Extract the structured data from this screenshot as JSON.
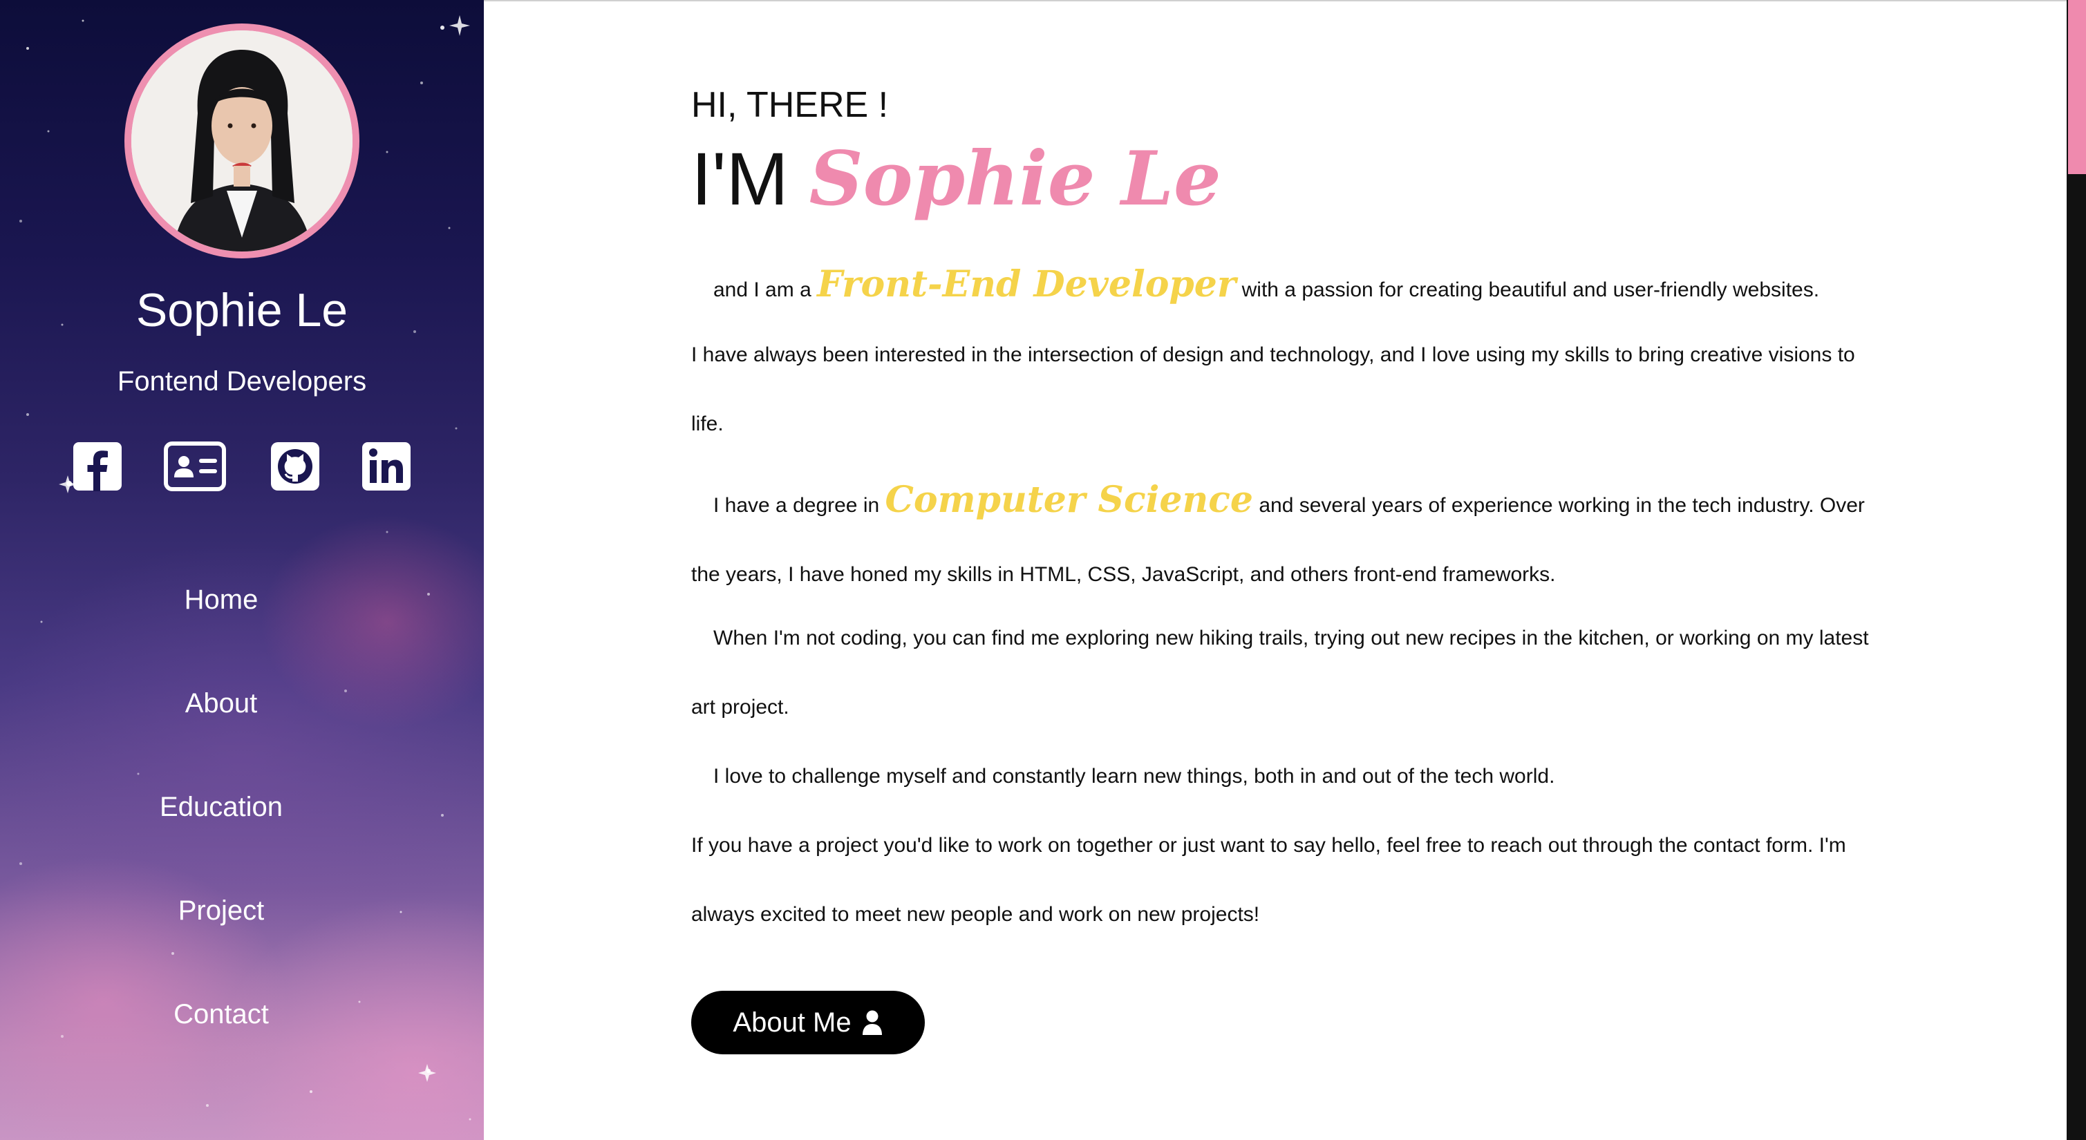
{
  "colors": {
    "accent_pink": "#ef8aae",
    "accent_yellow": "#f5d34a",
    "button_bg": "#000000",
    "sidebar_top": "#0d0d3a",
    "sidebar_bottom": "#c995c4"
  },
  "sidebar": {
    "avatar_alt": "Sophie Le profile photo",
    "name": "Sophie Le",
    "role": "Fontend Developers",
    "social": [
      {
        "icon": "facebook-icon"
      },
      {
        "icon": "contact-card-icon"
      },
      {
        "icon": "github-icon"
      },
      {
        "icon": "linkedin-icon"
      }
    ],
    "nav": [
      {
        "label": "Home"
      },
      {
        "label": "About"
      },
      {
        "label": "Education"
      },
      {
        "label": "Project"
      },
      {
        "label": "Contact"
      }
    ]
  },
  "main": {
    "greeting": "HI, THERE !",
    "intro_prefix": "I'M",
    "intro_name": "Sophie Le",
    "p1": {
      "before": "and I am a",
      "highlight": "Front-End Developer",
      "after": "with a passion for creating beautiful and user-friendly websites."
    },
    "p2": "I have always been interested in the intersection of design and technology, and I love using my skills to bring creative visions to life.",
    "p3": {
      "before": "I have a degree in",
      "highlight": "Computer Science",
      "after": "and several years of experience working in the tech industry. Over the years, I have honed my skills in HTML, CSS, JavaScript, and others front-end frameworks."
    },
    "p4": "When I'm not coding, you can find me exploring new hiking trails, trying out new recipes in the kitchen, or working on my latest art project.",
    "p5": "I love to challenge myself and constantly learn new things, both in and out of the tech world.",
    "p6": "If you have a project you'd like to work on together or just want to say hello, feel free to reach out through the contact form. I'm always excited to meet new people and work on new projects!",
    "button_label": "About Me",
    "button_icon": "user-icon"
  }
}
